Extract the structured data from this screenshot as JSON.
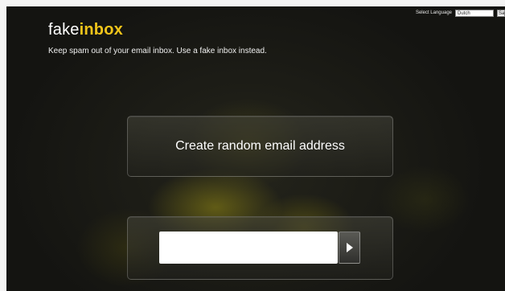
{
  "header": {
    "language_label": "Select Language",
    "language_value": "Dutch",
    "save_label": "Sav"
  },
  "brand": {
    "logo_part1": "fake",
    "logo_part2": "inbox",
    "tagline": "Keep spam out of  your email inbox. Use a fake inbox instead.",
    "accent_color": "#f2c51a"
  },
  "main": {
    "create_button_label": "Create random email address",
    "email_input_value": "",
    "go_button_icon": "play-arrow-icon"
  }
}
